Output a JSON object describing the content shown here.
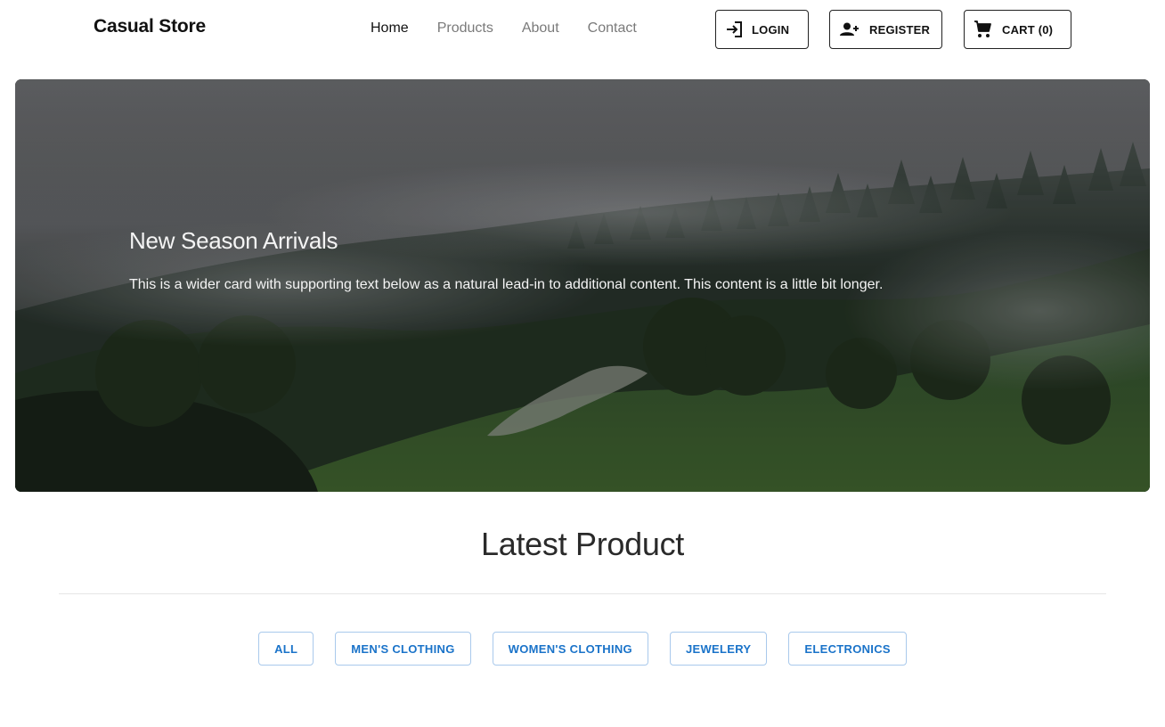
{
  "navbar": {
    "brand": "Casual Store",
    "links": [
      {
        "label": "Home",
        "active": true
      },
      {
        "label": "Products",
        "active": false
      },
      {
        "label": "About",
        "active": false
      },
      {
        "label": "Contact",
        "active": false
      }
    ],
    "buttons": {
      "login": {
        "label": "LOGIN",
        "icon": "login-icon"
      },
      "register": {
        "label": "REGISTER",
        "icon": "person-add-icon"
      },
      "cart": {
        "label": "CART (0)",
        "icon": "cart-icon"
      }
    }
  },
  "hero": {
    "title": "New Season Arrivals",
    "text": "This is a wider card with supporting text below as a natural lead-in to additional content. This content is a little bit longer.",
    "image_description_icon": "misty-forest-image"
  },
  "latest": {
    "title": "Latest Product",
    "filters": [
      "ALL",
      "MEN'S CLOTHING",
      "WOMEN'S CLOTHING",
      "JEWELERY",
      "ELECTRONICS"
    ]
  },
  "colors": {
    "filter_accent": "#1a73c9",
    "filter_border": "#a9c9ec",
    "text_dark": "#111111",
    "nav_muted": "#7a7a7a"
  }
}
